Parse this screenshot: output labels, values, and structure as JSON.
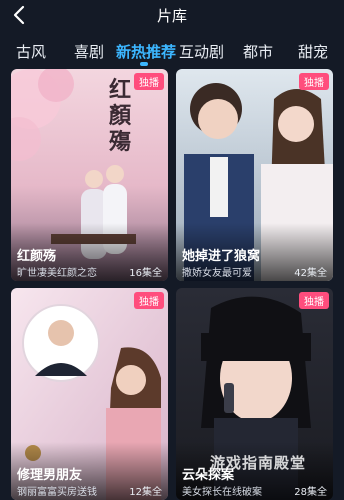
{
  "header": {
    "title": "片库",
    "back_icon": "chevron-left-icon"
  },
  "tabs": [
    {
      "label": "古风",
      "active": false
    },
    {
      "label": "喜剧",
      "active": false
    },
    {
      "label": "新热推荐",
      "active": true
    },
    {
      "label": "互动剧",
      "active": false
    },
    {
      "label": "都市",
      "active": false
    },
    {
      "label": "甜宠",
      "active": false
    }
  ],
  "cards": [
    {
      "title": "红颜殇",
      "subtitle": "旷世凄美红颜之恋",
      "episodes": "16集全",
      "badge": "独播",
      "poster_text": "红顏殤"
    },
    {
      "title": "她掉进了狼窝",
      "subtitle": "撒娇女友最可爱",
      "episodes": "42集全",
      "badge": "独播"
    },
    {
      "title": "修理男朋友",
      "subtitle": "钢丽富富买房送钱",
      "episodes": "12集全",
      "badge": "独播"
    },
    {
      "title": "云朵探案",
      "subtitle": "美女探长在线破案",
      "episodes": "28集全",
      "badge": "独播"
    }
  ],
  "watermark": "游戏指南殿堂",
  "colors": {
    "accent": "#3cb6ff",
    "badge": "#ff4d7d",
    "background": "#141a26"
  }
}
